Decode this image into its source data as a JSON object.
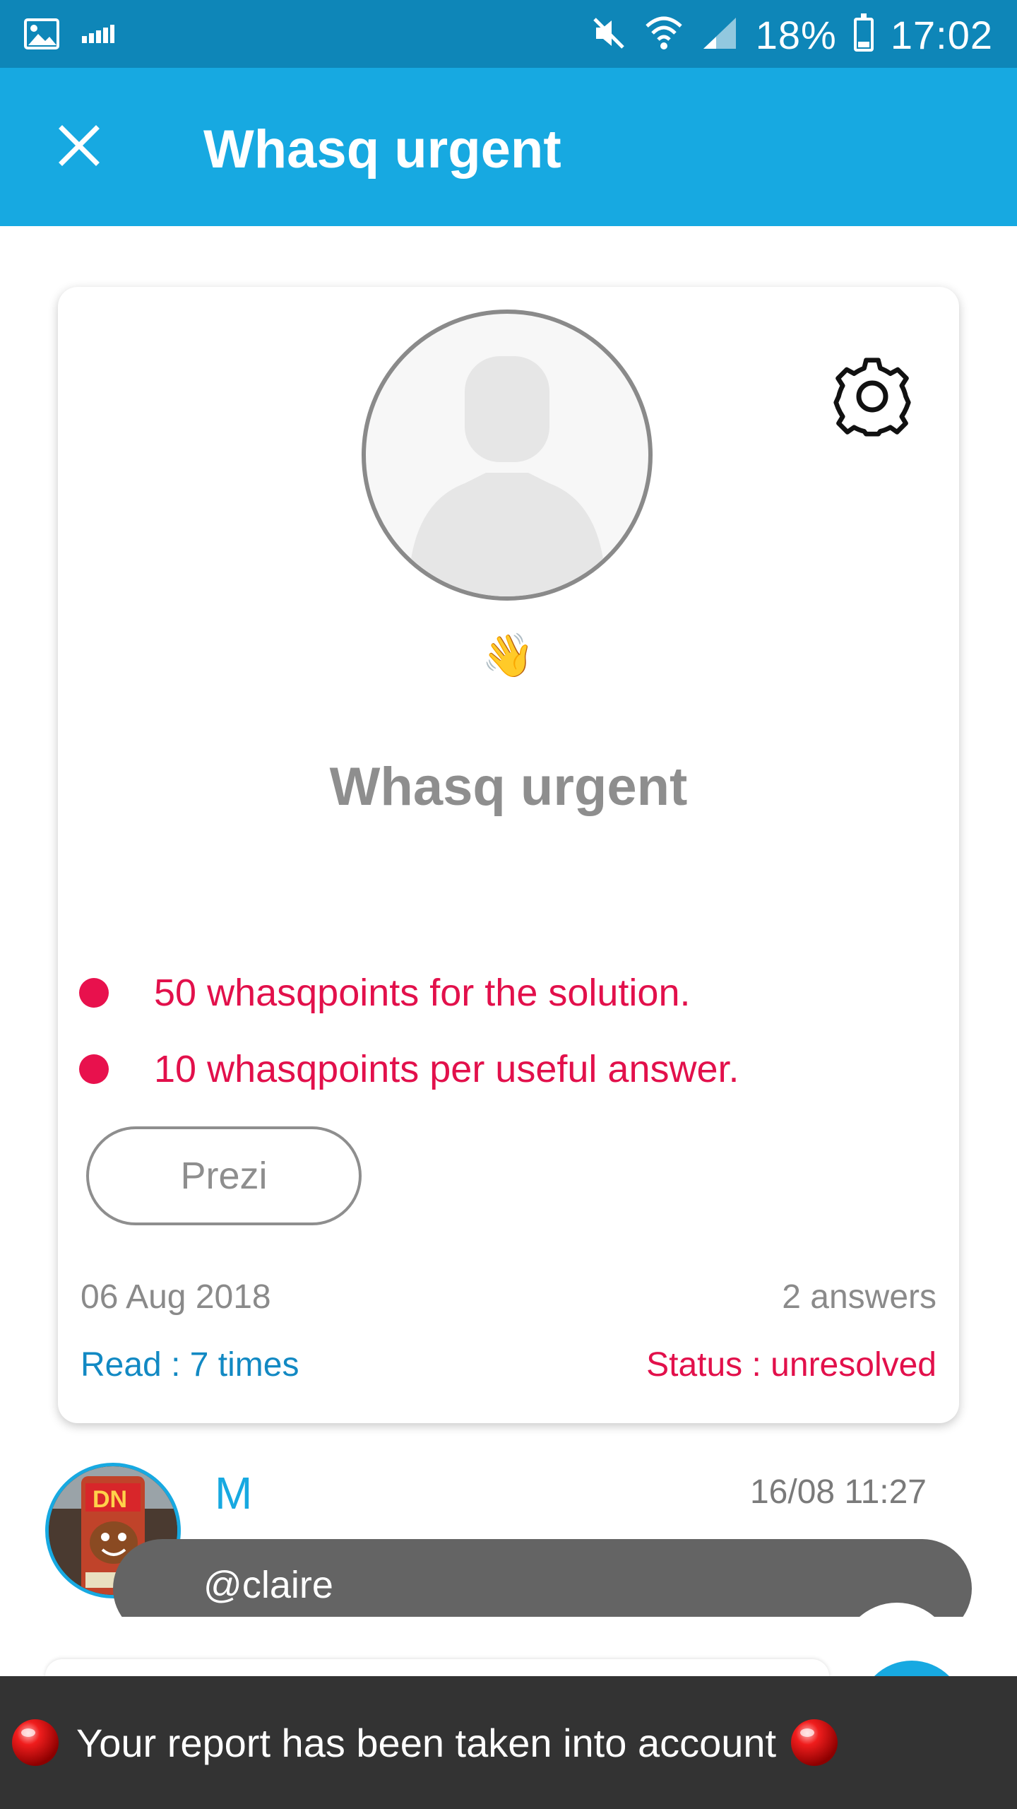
{
  "status_bar": {
    "battery_percent": "18%",
    "time": "17:02",
    "icons": [
      "image-icon",
      "signal-bars-icon",
      "mute-icon",
      "wifi-icon",
      "cell-signal-icon",
      "battery-icon"
    ]
  },
  "app_bar": {
    "title": "Whasq urgent",
    "close_icon": "close-icon",
    "background": "#17a9e1"
  },
  "card": {
    "title": "Whasq urgent",
    "wave_emoji": "👋",
    "settings_icon": "gear-icon",
    "rewards": [
      "50 whasqpoints for the solution.",
      "10 whasqpoints per useful answer."
    ],
    "tag_button": "Prezi",
    "date": "06 Aug 2018",
    "answers": "2 answers",
    "read_count": "Read : 7 times",
    "status": "Status : unresolved",
    "accent_color": "#e2104b",
    "link_color": "#1289c3"
  },
  "message": {
    "author": "M",
    "time": "16/08 11:27",
    "text": "@claire"
  },
  "snackbar": {
    "text": "Your report has been taken into account",
    "icon": "red-ball-icon"
  }
}
